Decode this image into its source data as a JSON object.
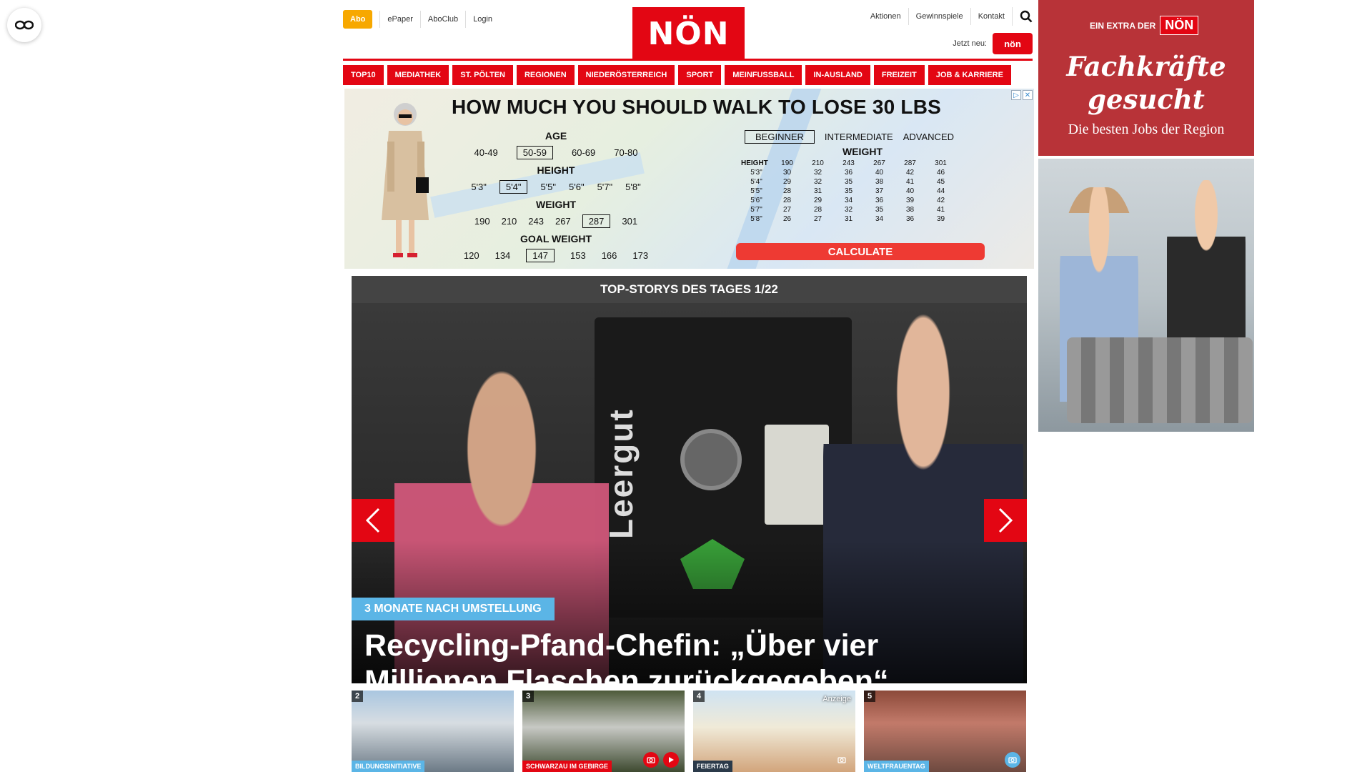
{
  "header": {
    "abo": "Abo",
    "top_links": [
      "ePaper",
      "AboClub",
      "Login"
    ],
    "logo": "NÖN",
    "right_links": [
      "Aktionen",
      "Gewinnspiele",
      "Kontakt"
    ],
    "jetzt_neu": "Jetzt neu:",
    "jetzt_badge": "nön"
  },
  "nav": {
    "items": [
      "TOP10",
      "MEDIATHEK",
      "ST. PÖLTEN",
      "REGIONEN",
      "NIEDERÖSTERREICH",
      "SPORT",
      "MEINFUSSBALL",
      "IN-AUSLAND",
      "FREIZEIT",
      "JOB & KARRIERE"
    ]
  },
  "ad": {
    "title": "HOW MUCH YOU SHOULD WALK TO LOSE 30 LBS",
    "age_label": "AGE",
    "ages": [
      "40-49",
      "50-59",
      "60-69",
      "70-80"
    ],
    "height_label": "HEIGHT",
    "heights": [
      "5'3\"",
      "5'4\"",
      "5'5\"",
      "5'6\"",
      "5'7\"",
      "5'8\""
    ],
    "weight_label": "WEIGHT",
    "weights": [
      "190",
      "210",
      "243",
      "267",
      "287",
      "301"
    ],
    "goal_label": "GOAL WEIGHT",
    "goals": [
      "120",
      "134",
      "147",
      "153",
      "166",
      "173"
    ],
    "levels": [
      "BEGINNER",
      "INTERMEDIATE",
      "ADVANCED"
    ],
    "table_weight_label": "WEIGHT",
    "table_height_label": "HEIGHT",
    "table_weights": [
      "190",
      "210",
      "243",
      "267",
      "287",
      "301"
    ],
    "table_rows": [
      {
        "h": "5'3\"",
        "v": [
          "30",
          "32",
          "36",
          "40",
          "42",
          "46"
        ]
      },
      {
        "h": "5'4\"",
        "v": [
          "29",
          "32",
          "35",
          "38",
          "41",
          "45"
        ]
      },
      {
        "h": "5'5\"",
        "v": [
          "28",
          "31",
          "35",
          "37",
          "40",
          "44"
        ]
      },
      {
        "h": "5'6\"",
        "v": [
          "28",
          "29",
          "34",
          "36",
          "39",
          "42"
        ]
      },
      {
        "h": "5'7\"",
        "v": [
          "27",
          "28",
          "32",
          "35",
          "38",
          "41"
        ]
      },
      {
        "h": "5'8\"",
        "v": [
          "26",
          "27",
          "31",
          "34",
          "36",
          "39"
        ]
      }
    ],
    "calculate": "CALCULATE"
  },
  "stories": {
    "heading": "TOP-STORYS DES TAGES 1/22",
    "machine_text": "Leergut",
    "kicker": "3 MONATE NACH UMSTELLUNG",
    "headline": "Recycling-Pfand-Chefin: „Über vier Millionen Flaschen zurückgegeben“"
  },
  "thumbs": [
    {
      "num": "2",
      "tag": "Bildungsinitiative",
      "tag_color": "#5bb5e6"
    },
    {
      "num": "3",
      "tag": "Schwarzau im Gebirge",
      "tag_color": "#e30613"
    },
    {
      "num": "4",
      "tag": "Feiertag",
      "tag_color": "#2b3a4a",
      "anzeige": "Anzeige"
    },
    {
      "num": "5",
      "tag": "Weltfrauentag",
      "tag_color": "#5bb5e6"
    }
  ],
  "right_ad": {
    "extra": "EIN EXTRA DER",
    "extra_logo": "NÖN",
    "title_line1": "Fachkräfte",
    "title_line2": "gesucht",
    "subtitle": "Die besten Jobs der Region"
  },
  "colors": {
    "brand_red": "#e30613",
    "abo_orange": "#f7a800",
    "kicker_blue": "#5bb5e6",
    "right_ad_red": "#b83338"
  }
}
